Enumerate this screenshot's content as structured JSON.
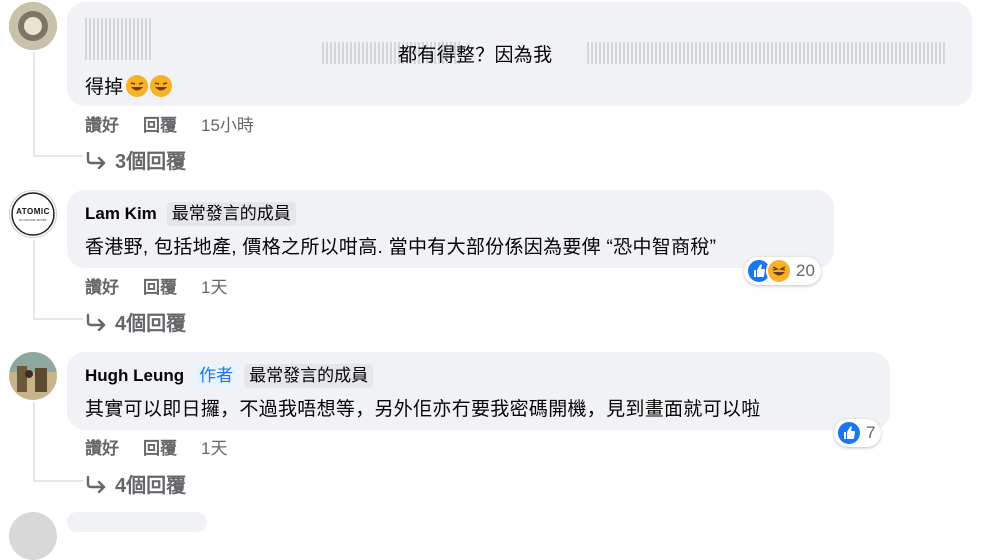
{
  "comments": [
    {
      "id": "c1",
      "name": "",
      "text_line1": "都有得整？因為我",
      "text_line2": "得掉",
      "actions": {
        "like": "讚好",
        "reply": "回覆",
        "time": "15小時"
      },
      "replies_label": "3個回覆"
    },
    {
      "id": "c2",
      "name": "Lam Kim",
      "badge": "最常發言的成員",
      "avatar_text": "ATOMIC",
      "avatar_subtext": "RC MOTOR SPORT",
      "text": "香港野, 包括地產, 價格之所以咁高. 當中有大部份係因為要俾 “恐中智商稅”",
      "actions": {
        "like": "讚好",
        "reply": "回覆",
        "time": "1天"
      },
      "reaction_count": "20",
      "replies_label": "4個回覆"
    },
    {
      "id": "c3",
      "name": "Hugh Leung",
      "author_badge": "作者",
      "badge": "最常發言的成員",
      "text": "其實可以即日攞，不過我唔想等，另外佢亦冇要我密碼開機，見到畫面就可以啦",
      "actions": {
        "like": "讚好",
        "reply": "回覆",
        "time": "1天"
      },
      "reaction_count": "7",
      "replies_label": "4個回覆"
    }
  ],
  "colors": {
    "like_blue": "#1877f2",
    "haha_yellow": "#f7b125",
    "bubble": "#f0f2f5",
    "muted": "#65676b"
  }
}
